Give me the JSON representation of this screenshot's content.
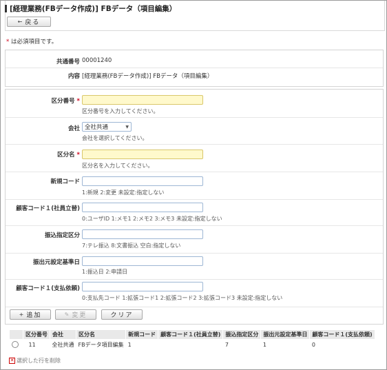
{
  "header": {
    "title": "[経理業務(FBデータ作成)] FBデータ（項目編集）",
    "back_label": "戻る",
    "back_icon": "arrow-left-icon"
  },
  "required_note": {
    "star": "*",
    "text": " は必須項目です。"
  },
  "info": {
    "common_no_label": "共通番号",
    "common_no_value": "00001240",
    "content_label": "内容",
    "content_value": "[経理業務(FBデータ作成)] FBデータ（項目編集）"
  },
  "form": {
    "kubun_no": {
      "label": "区分番号",
      "required": "*",
      "value": "",
      "hint": "区分番号を入力してください。"
    },
    "company": {
      "label": "会社",
      "selected": "全社共通",
      "hint": "会社を選択してください。"
    },
    "kubun_name": {
      "label": "区分名",
      "required": "*",
      "value": "",
      "hint": "区分名を入力してください。"
    },
    "new_code": {
      "label": "新規コード",
      "value": "",
      "hint": "1:新規 2:変更 未設定:指定しない"
    },
    "customer_code1": {
      "label": "顧客コード１(社員立替)",
      "value": "",
      "hint": "0:ユーザID 1:メモ1 2:メモ2 3:メモ3 未設定:指定しない"
    },
    "transfer_kubun": {
      "label": "振込指定区分",
      "value": "",
      "hint": "7:テレ振込 8:文書振込 空白:指定しない"
    },
    "withdraw_base_date": {
      "label": "振出元設定基準日",
      "value": "",
      "hint": "1:振込日 2:申請日"
    },
    "customer_code2": {
      "label": "顧客コード１(支払依頼)",
      "value": "",
      "hint": "0:支払先コード 1:拡張コード1 2:拡張コード2 3:拡張コード3 未設定:指定しない"
    }
  },
  "actions": {
    "add_label": "追加",
    "change_label": "変更",
    "clear_label": "クリア"
  },
  "table": {
    "headers": [
      "",
      "区分番号",
      "会社",
      "区分名",
      "新規コード",
      "顧客コード１(社員立替)",
      "振込指定区分",
      "振出元設定基準日",
      "顧客コード１(支払依頼)"
    ],
    "rows": [
      [
        "",
        "11",
        "全社共通",
        "FBデータ項目編集",
        "1",
        "",
        "7",
        "1",
        "0"
      ]
    ]
  },
  "delete_selected_label": "選択した行を削除",
  "colors": {
    "required_bg": "#fff9cc",
    "required_star": "#d0021b",
    "input_border": "#9db6d4"
  }
}
